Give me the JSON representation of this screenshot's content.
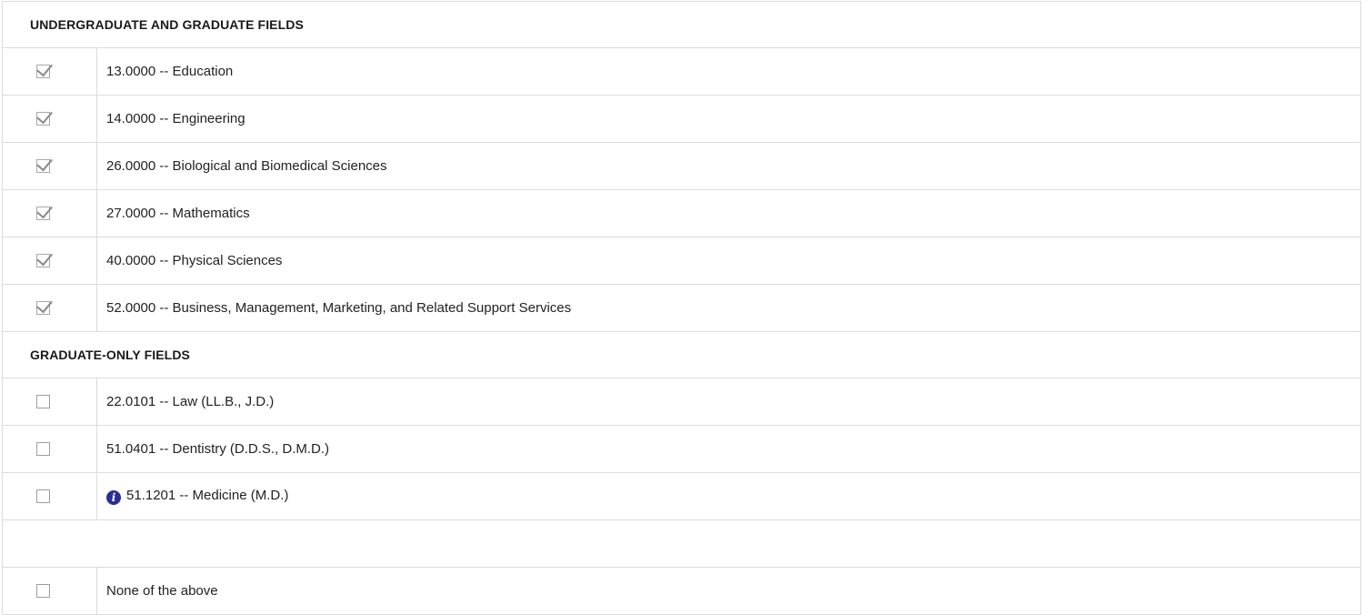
{
  "sections": [
    {
      "title": "UNDERGRADUATE AND GRADUATE FIELDS",
      "items": [
        {
          "label": "13.0000 -- Education",
          "checked": true
        },
        {
          "label": "14.0000 -- Engineering",
          "checked": true
        },
        {
          "label": "26.0000 -- Biological and Biomedical Sciences",
          "checked": true
        },
        {
          "label": "27.0000 -- Mathematics",
          "checked": true
        },
        {
          "label": "40.0000 -- Physical Sciences",
          "checked": true
        },
        {
          "label": "52.0000 -- Business, Management, Marketing, and Related Support Services",
          "checked": true
        }
      ]
    },
    {
      "title": "GRADUATE-ONLY FIELDS",
      "items": [
        {
          "label": "22.0101 -- Law (LL.B., J.D.)",
          "checked": false
        },
        {
          "label": "51.0401 -- Dentistry (D.D.S., D.M.D.)",
          "checked": false
        },
        {
          "label": "51.1201 -- Medicine (M.D.)",
          "checked": false,
          "icon": "info-icon"
        }
      ]
    }
  ],
  "none_option": {
    "label": "None of the above",
    "checked": false
  },
  "colors": {
    "info_icon": "#2b2d8f",
    "border": "#dcdcdc",
    "checkmark": "#8a8a8a"
  }
}
